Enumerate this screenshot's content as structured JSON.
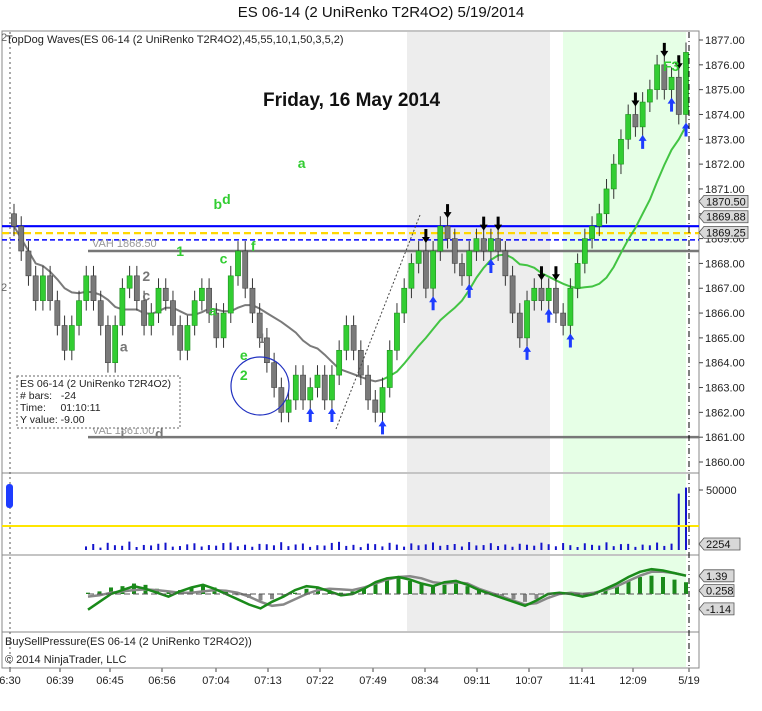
{
  "window": {
    "title": "ES 06-14 (2 UniRenko T2R4O2)  5/19/2014"
  },
  "indicator_label": "TopDog Waves(ES 06-14 (2 UniRenko T2R4O2),45,55,10,1,50,3,5,2)",
  "date_heading": "Friday, 16 May 2014",
  "bsp_label": "BuySellPressure(ES 06-14 (2 UniRenko T2R4O2))",
  "copyright": "© 2014 NinjaTrader, LLC",
  "data_box": {
    "line1": "ES 06-14 (2 UniRenko T2R4O2)",
    "line2": "# bars:   -24",
    "line3": "Time:     01:10:11",
    "line4": "Y value: -9.00"
  },
  "level_labels": {
    "vah": "VAH 1868.50",
    "val": "VAL 1861.00"
  },
  "edge_markers": {
    "top": "2",
    "mid": "2"
  },
  "corner_label": "F3",
  "colors": {
    "up_bar": "#32cd32",
    "down_bar": "#7a7a7a",
    "signal_arrow": "#1e3cff",
    "price_line": "#0000ff",
    "yellow_line": "#ffd700",
    "ma_green": "#43c443",
    "ma_gray": "#7a7a7a",
    "volume": "#1414cc",
    "highlight_bg": "#e6ffe6",
    "gray_bg": "#ededed"
  },
  "chart_data": [
    {
      "type": "line",
      "name": "price",
      "y_ticks": [
        "1877.00",
        "1876.00",
        "1875.00",
        "1874.00",
        "1873.00",
        "1872.00",
        "1871.00",
        "1870.00",
        "1869.00",
        "1868.00",
        "1867.00",
        "1866.00",
        "1865.00",
        "1864.00",
        "1863.00",
        "1862.00",
        "1861.00",
        "1860.00"
      ],
      "ylim": [
        1859.6,
        1877.4
      ],
      "x_ticks": [
        "6:30",
        "06:39",
        "06:45",
        "06:56",
        "07:04",
        "07:13",
        "07:22",
        "07:49",
        "08:34",
        "09:11",
        "10:07",
        "11:41",
        "12:09",
        "5/19"
      ],
      "price_flags": [
        {
          "label": "1870.50",
          "value": 1870.5,
          "style": "gray"
        },
        {
          "label": "1869.88",
          "value": 1869.88,
          "style": "gray"
        },
        {
          "label": "1869.25",
          "value": 1869.25,
          "style": "gray"
        }
      ],
      "levels": [
        {
          "name": "blue-line",
          "value": 1869.5
        },
        {
          "name": "yellow-dashed",
          "value": 1869.22
        },
        {
          "name": "blue-dashed",
          "value": 1868.95
        },
        {
          "name": "vah-line",
          "value": 1868.5
        },
        {
          "name": "val-line",
          "value": 1861.0
        }
      ],
      "close_series": [
        1869.5,
        1868.5,
        1867.5,
        1866.5,
        1867.5,
        1866.5,
        1865.5,
        1864.5,
        1865.5,
        1866.5,
        1867.5,
        1866.5,
        1865.5,
        1864.0,
        1865.5,
        1867.0,
        1867.5,
        1866.5,
        1865.5,
        1866.0,
        1867.0,
        1866.5,
        1865.5,
        1864.5,
        1865.5,
        1866.5,
        1867.0,
        1866.0,
        1865.0,
        1866.0,
        1867.5,
        1868.5,
        1867.0,
        1866.0,
        1865.0,
        1864.0,
        1863.0,
        1862.0,
        1862.5,
        1863.5,
        1862.5,
        1863.0,
        1863.5,
        1862.5,
        1863.5,
        1864.5,
        1865.5,
        1864.5,
        1863.5,
        1862.5,
        1862.0,
        1863.0,
        1864.5,
        1866.0,
        1867.0,
        1868.0,
        1868.5,
        1867.0,
        1868.5,
        1869.5,
        1869.0,
        1868.0,
        1867.5,
        1868.5,
        1869.0,
        1868.5,
        1869.0,
        1868.5,
        1867.5,
        1866.0,
        1865.0,
        1866.5,
        1867.0,
        1866.5,
        1867.0,
        1866.0,
        1865.5,
        1867.0,
        1868.0,
        1869.0,
        1869.5,
        1870.0,
        1871.0,
        1872.0,
        1873.0,
        1874.0,
        1873.5,
        1874.5,
        1875.0,
        1876.0,
        1875.0,
        1875.5,
        1874.0,
        1876.5
      ],
      "annotations": [
        {
          "text": "a",
          "x_index": 15.2,
          "value": 1864.45,
          "color": "#777777"
        },
        {
          "text": "b",
          "x_index": 17.5,
          "value": 1861.55,
          "color": "#777777"
        },
        {
          "text": "i",
          "x_index": 15.0,
          "value": 1860.95,
          "color": "#777777"
        },
        {
          "text": "2",
          "x_index": 18.3,
          "value": 1867.3,
          "color": "#777777"
        },
        {
          "text": "c",
          "x_index": 18.3,
          "value": 1866.5,
          "color": "#777777"
        },
        {
          "text": "d",
          "x_index": 20.1,
          "value": 1860.95,
          "color": "#777777"
        },
        {
          "text": "1",
          "x_index": 23.0,
          "value": 1868.3,
          "color": "#32cd32"
        },
        {
          "text": "b",
          "x_index": 28.2,
          "value": 1870.2,
          "color": "#32cd32"
        },
        {
          "text": "d",
          "x_index": 29.4,
          "value": 1870.4,
          "color": "#32cd32"
        },
        {
          "text": "c",
          "x_index": 29.0,
          "value": 1868.0,
          "color": "#32cd32"
        },
        {
          "text": "a",
          "x_index": 27.5,
          "value": 1865.9,
          "color": "#32cd32"
        },
        {
          "text": "f",
          "x_index": 33.1,
          "value": 1868.5,
          "color": "#32cd32"
        },
        {
          "text": "e",
          "x_index": 31.8,
          "value": 1864.1,
          "color": "#32cd32"
        },
        {
          "text": "2",
          "x_index": 31.8,
          "value": 1863.3,
          "color": "#32cd32"
        },
        {
          "text": "1",
          "x_index": 34.3,
          "value": 1864.8,
          "color": "#777777"
        },
        {
          "text": "a",
          "x_index": 39.8,
          "value": 1871.85,
          "color": "#32cd32"
        }
      ]
    },
    {
      "type": "bar",
      "name": "volume",
      "y_ticks": [
        "50000"
      ],
      "price_flags": [
        {
          "label": "2254",
          "value": 2254,
          "style": "gray"
        }
      ],
      "levels": [
        {
          "name": "volume-average-line",
          "value": 25000
        }
      ],
      "values": [
        3000,
        5000,
        2000,
        6000,
        4000,
        3500,
        7000,
        2500,
        4200,
        3800,
        5200,
        6100,
        2800,
        3300,
        4700,
        5600,
        2900,
        4100,
        3600,
        5800,
        6200,
        3100,
        4400,
        2700,
        5100,
        4800,
        3900,
        6500,
        3200,
        4600,
        5400,
        2600,
        4000,
        3700,
        5900,
        6800,
        3400,
        4300,
        2400,
        5300,
        4900,
        3000,
        6000,
        4500,
        2800,
        5500,
        3900,
        4700,
        6300,
        3500,
        4200,
        5000,
        2900,
        6600,
        3800,
        4100,
        5700,
        3300,
        4600,
        2700,
        5200,
        4400,
        3600,
        6100,
        4800,
        3100,
        5800,
        4000,
        2500,
        5600,
        4300,
        3700,
        6400,
        3200,
        4900,
        5100,
        2600,
        4500,
        3900,
        6200,
        3400,
        5300,
        47000,
        52000
      ]
    },
    {
      "type": "line",
      "name": "oscillator",
      "price_flags": [
        {
          "label": "1.39",
          "value": 1.39,
          "style": "gray"
        },
        {
          "label": "0.258",
          "value": 0.258,
          "style": "gray"
        },
        {
          "label": "-1.14",
          "value": -1.14,
          "style": "gray"
        }
      ],
      "ylim": [
        -2.6,
        2.6
      ],
      "fast_values": [
        -1.2,
        -0.6,
        0.0,
        0.3,
        0.6,
        0.4,
        0.1,
        -0.2,
        0.2,
        0.5,
        0.7,
        0.4,
        0.0,
        -0.4,
        -0.8,
        -1.1,
        -0.6,
        -0.2,
        0.3,
        0.6,
        0.5,
        0.2,
        -0.1,
        0.0,
        0.4,
        0.9,
        1.2,
        1.3,
        1.1,
        0.8,
        0.6,
        0.9,
        1.0,
        0.7,
        0.3,
        0.0,
        -0.3,
        -0.6,
        -0.9,
        -0.5,
        0.0,
        0.1,
        0.0,
        -0.2,
        0.0,
        0.4,
        0.8,
        1.3,
        1.7,
        1.9,
        1.8,
        1.6,
        1.4
      ],
      "slow_values": [
        -0.2,
        -0.1,
        0.1,
        0.2,
        0.3,
        0.35,
        0.3,
        0.2,
        0.1,
        0.1,
        0.2,
        0.3,
        0.25,
        0.1,
        -0.2,
        -0.6,
        -0.9,
        -0.8,
        -0.4,
        0.0,
        0.3,
        0.4,
        0.35,
        0.3,
        0.5,
        0.8,
        1.1,
        1.3,
        1.35,
        1.2,
        0.9,
        0.8,
        0.9,
        0.8,
        0.4,
        0.1,
        -0.2,
        -0.5,
        -0.8,
        -0.7,
        -0.3,
        0.0,
        0.1,
        0.0,
        0.1,
        0.3,
        0.6,
        1.0,
        1.4,
        1.7,
        1.7,
        1.6,
        1.4
      ],
      "histogram": [
        0.1,
        0.2,
        0.5,
        0.6,
        0.8,
        0.7,
        0.4,
        0.2,
        0.3,
        0.5,
        0.7,
        0.5,
        0.2,
        -0.1,
        -0.3,
        -0.5,
        -0.4,
        -0.2,
        0.1,
        0.4,
        0.5,
        0.3,
        0.1,
        0.2,
        0.5,
        0.9,
        1.1,
        1.2,
        1.0,
        0.8,
        0.6,
        0.7,
        0.8,
        0.6,
        0.3,
        0.0,
        -0.2,
        -0.4,
        -0.6,
        -0.4,
        -0.1,
        0.0,
        0.0,
        -0.1,
        0.1,
        0.3,
        0.6,
        1.0,
        1.3,
        1.4,
        1.3,
        1.1,
        0.9
      ]
    }
  ]
}
